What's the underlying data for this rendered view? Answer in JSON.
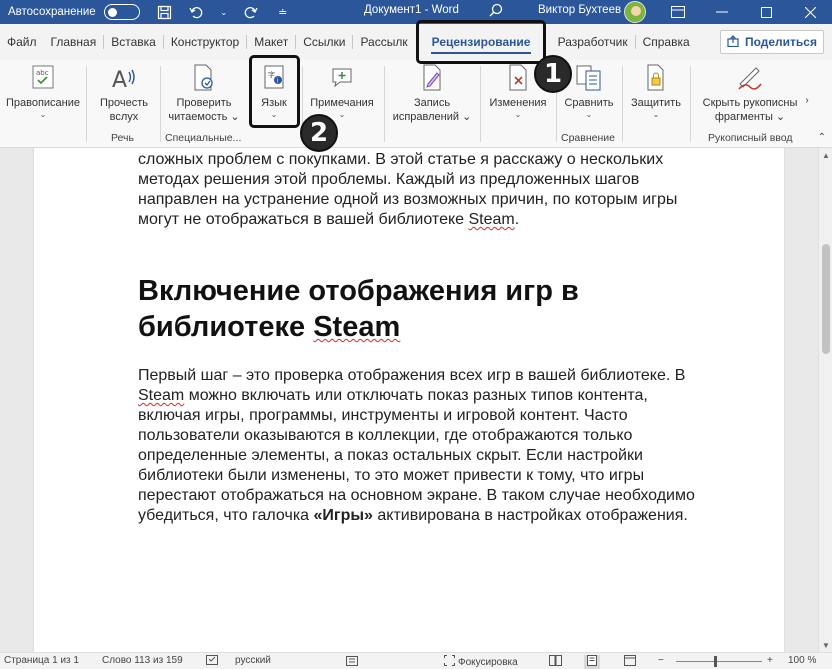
{
  "titlebar": {
    "autosave_label": "Автосохранение",
    "autosave_state": "Откл.",
    "doc_title": "Документ1 - Word",
    "user_name": "Виктор Бухтеев",
    "icons": [
      "save-icon",
      "undo-icon",
      "redo-icon",
      "customize-icon",
      "search-icon",
      "ribbon-display-icon",
      "minimize-icon",
      "maximize-icon",
      "close-icon"
    ]
  },
  "tabs": [
    {
      "label": "Файл"
    },
    {
      "label": "Главная"
    },
    {
      "label": "Вставка"
    },
    {
      "label": "Конструктор"
    },
    {
      "label": "Макет"
    },
    {
      "label": "Ссылки"
    },
    {
      "label": "Рассылк"
    },
    {
      "label": "Рецензирование",
      "active": true
    },
    {
      "label": "Разработчик"
    },
    {
      "label": "Справка"
    }
  ],
  "share_label": "Поделиться",
  "ribbon": {
    "spelling": {
      "label1": "Правописание",
      "chev": "⌄"
    },
    "read_aloud": {
      "label1": "Прочесть",
      "label2": "вслух"
    },
    "check_access": {
      "label1": "Проверить",
      "label2": "читаемость ⌄"
    },
    "language": {
      "label1": "Язык",
      "chev": "⌄"
    },
    "comments": {
      "label1": "Примечания",
      "chev": "⌄"
    },
    "track_changes": {
      "label1": "Запись",
      "label2": "исправлений ⌄"
    },
    "changes": {
      "label1": "Изменения",
      "chev": "⌄"
    },
    "compare": {
      "label1": "Сравнить",
      "chev": "⌄"
    },
    "protect": {
      "label1": "Защитить",
      "chev": "⌄"
    },
    "hide_ink": {
      "label1": "Скрыть рукописны",
      "label2": "фрагменты ⌄"
    },
    "group_labels": {
      "speech": "Речь",
      "accessibility": "Специальные...",
      "compare": "Сравнение",
      "ink": "Рукописный ввод"
    }
  },
  "document": {
    "para1_lines": [
      "сложных проблем с покупками. В этой статье я расскажу о нескольких",
      "методах решения этой проблемы. Каждый из предложенных шагов",
      "направлен на устранение одной из возможных причин, по которым игры",
      "могут не отображаться в вашей библиотеке "
    ],
    "para1_end_word": "Steam",
    "para1_end_punct": ".",
    "heading_line1": "Включение отображения игр в",
    "heading_line2_prefix": "библиотеке ",
    "heading_line2_word": "Steam",
    "para2_line1": "Первый шаг – это проверка отображения всех игр в вашей библиотеке. В",
    "para2_line2_word": "Steam",
    "para2_line2_rest": " можно включать или отключать показ разных типов контента,",
    "para2_lines": [
      "включая игры, программы, инструменты и игровой контент. Часто",
      "пользователи оказываются в коллекции, где отображаются только",
      "определенные элементы, а показ остальных скрыт. Если настройки",
      "библиотеки были изменены, то это может привести к тому, что игры",
      "перестают отображаться на основном экране. В таком случае необходимо"
    ],
    "para2_last_prefix": "убедиться, что галочка ",
    "para2_last_bold": "«Игры»",
    "para2_last_suffix": " активирована в настройках отображения."
  },
  "statusbar": {
    "page": "Страница 1 из 1",
    "words": "Слово 113 из 159",
    "language": "русский",
    "focus": "Фокусировка",
    "zoom": "100 %",
    "zoom_minus": "−",
    "zoom_plus": "+"
  },
  "annotations": [
    {
      "number": "1",
      "target": "Рецензирование"
    },
    {
      "number": "2",
      "target": "Язык"
    }
  ]
}
